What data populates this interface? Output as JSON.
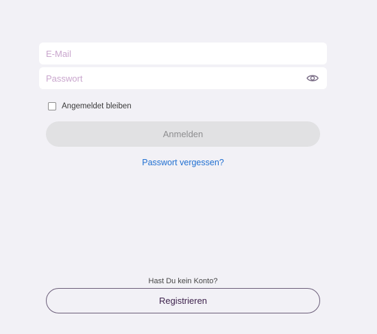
{
  "login_form": {
    "email_placeholder": "E-Mail",
    "email_value": "",
    "password_placeholder": "Passwort",
    "password_value": "",
    "show_password_icon": "eye-icon",
    "remember_label": "Angemeldet bleiben",
    "remember_checked": false,
    "login_label": "Anmelden",
    "forgot_label": "Passwort vergessen?"
  },
  "signup": {
    "prompt": "Hast Du kein Konto?",
    "register_label": "Registrieren"
  },
  "colors": {
    "background": "#f2f1f6",
    "placeholder": "#c9a6cd",
    "link": "#1f6fd1",
    "disabled_button": "#e1e1e3",
    "outline_button": "#6a5c78"
  }
}
